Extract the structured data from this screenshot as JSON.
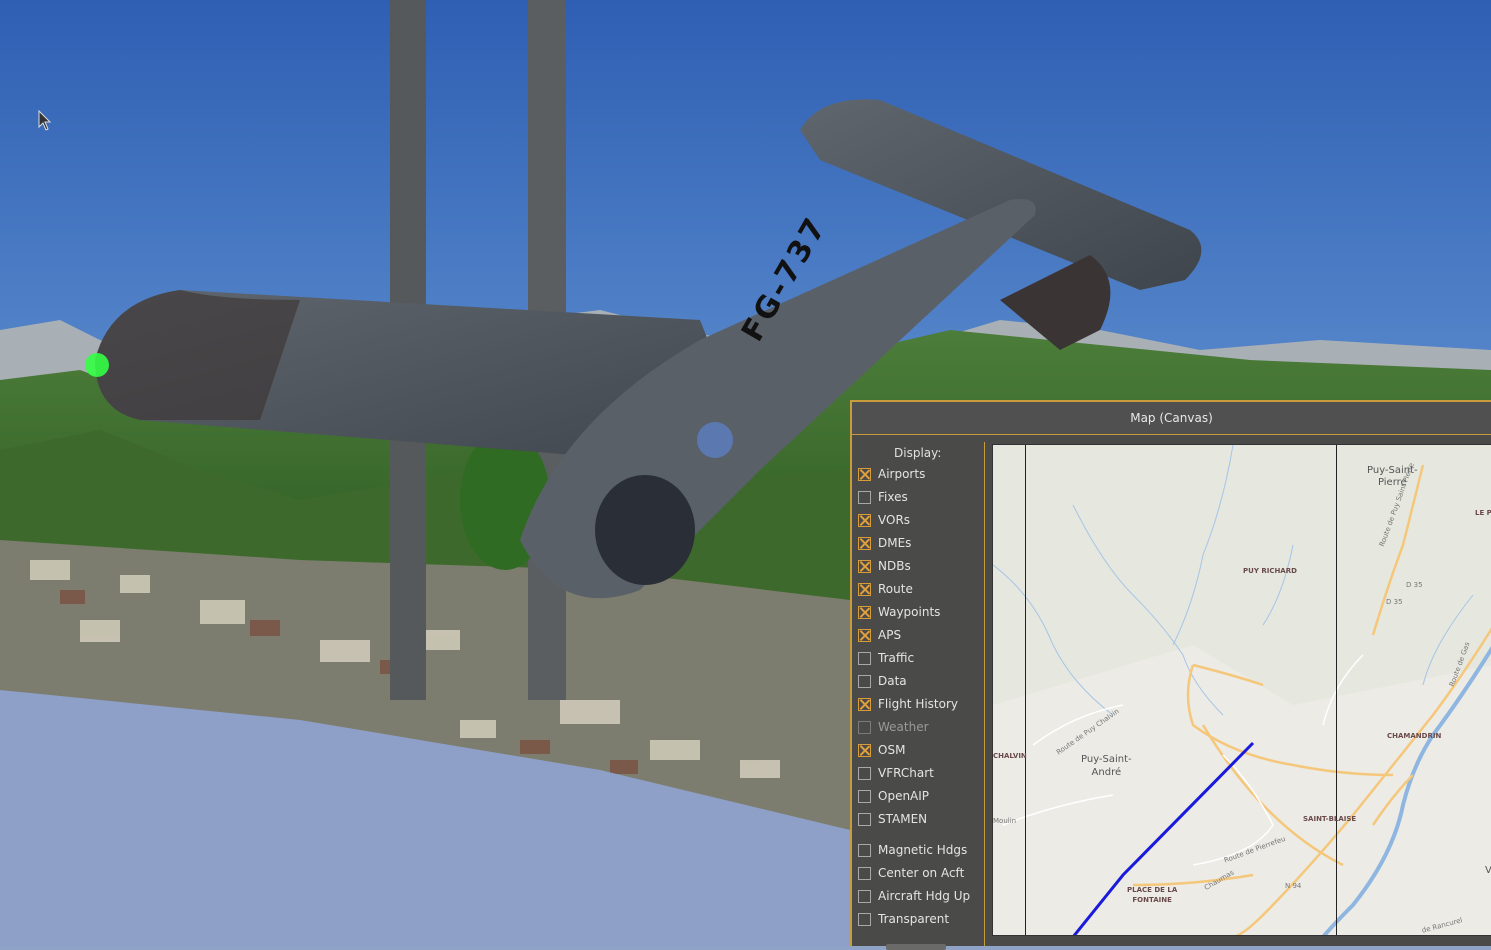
{
  "window": {
    "title": "Map (Canvas)"
  },
  "aircraft": {
    "registration": "FG-737"
  },
  "options": {
    "header": "Display:",
    "items": [
      {
        "label": "Airports",
        "checked": true,
        "enabled": true
      },
      {
        "label": "Fixes",
        "checked": false,
        "enabled": true
      },
      {
        "label": "VORs",
        "checked": true,
        "enabled": true
      },
      {
        "label": "DMEs",
        "checked": true,
        "enabled": true
      },
      {
        "label": "NDBs",
        "checked": true,
        "enabled": true
      },
      {
        "label": "Route",
        "checked": true,
        "enabled": true
      },
      {
        "label": "Waypoints",
        "checked": true,
        "enabled": true
      },
      {
        "label": "APS",
        "checked": true,
        "enabled": true
      },
      {
        "label": "Traffic",
        "checked": false,
        "enabled": true
      },
      {
        "label": "Data",
        "checked": false,
        "enabled": true
      },
      {
        "label": "Flight History",
        "checked": true,
        "enabled": true
      },
      {
        "label": "Weather",
        "checked": false,
        "enabled": false
      },
      {
        "label": "OSM",
        "checked": true,
        "enabled": true
      },
      {
        "label": "VFRChart",
        "checked": false,
        "enabled": true
      },
      {
        "label": "OpenAIP",
        "checked": false,
        "enabled": true
      },
      {
        "label": "STAMEN",
        "checked": false,
        "enabled": true
      }
    ],
    "extra": [
      {
        "label": "Magnetic Hdgs",
        "checked": false
      },
      {
        "label": "Center on Acft",
        "checked": false
      },
      {
        "label": "Aircraft Hdg Up",
        "checked": false
      },
      {
        "label": "Transparent",
        "checked": false
      }
    ]
  },
  "map": {
    "labels": {
      "puy_saint_pierre": "Puy-Saint-\nPierre",
      "puy_richard": "PUY RICHARD",
      "le": "LE P",
      "d35a": "D 35",
      "d35b": "D 35",
      "route_puy_saint_pierre": "Route de Puy Saint Pierre",
      "route_des_gas": "Route de Gas",
      "chamandrin": "CHAMANDRIN",
      "chalvin": "CHALVIN",
      "route_puy_chalvin": "Route de Puy Chalvin",
      "puy_saint_andre": "Puy-Saint-\nAndré",
      "moulin": "Moulin",
      "saint_blaise": "SAINT-BLAISE",
      "route_pierrefeu": "Route de Pierrefeu",
      "chaumas": "Chaumas",
      "n94": "N 94",
      "place_de_la_fontaine": "PLACE DE LA\nFONTAINE",
      "rancurel": "de Rancurel",
      "v": "V"
    },
    "colors": {
      "background": "#ecebe6",
      "road": "#f5c77a",
      "water": "#8fb6e0",
      "track": "#1a1adc"
    }
  }
}
